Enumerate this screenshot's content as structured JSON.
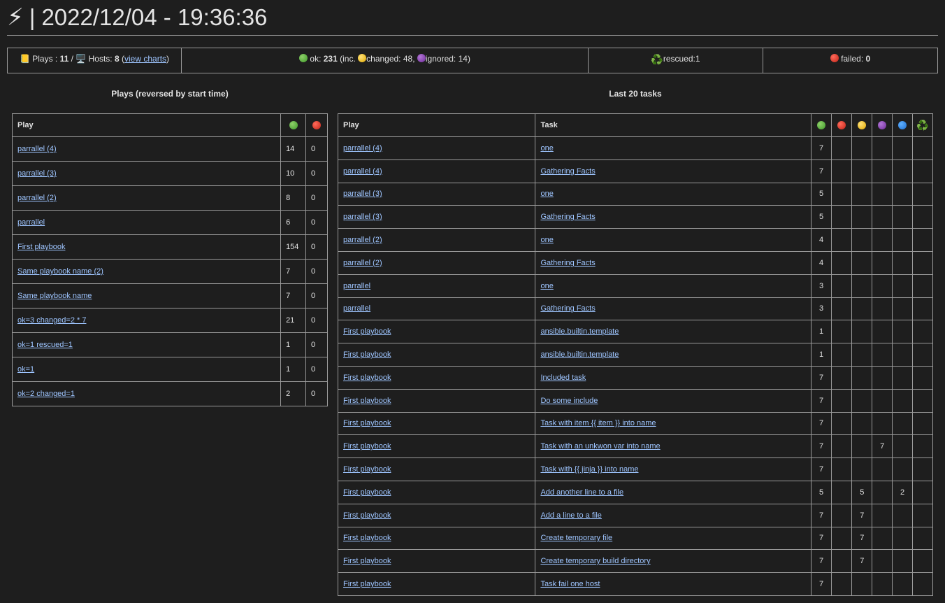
{
  "header": {
    "bolt_icon": "⚡",
    "separator": "|",
    "datetime": "2022/12/04 - 19:36:36"
  },
  "summary": {
    "plays_icon": "📒",
    "plays_label": "Plays :",
    "plays_count": "11",
    "slash": "/",
    "hosts_icon": "🖥️",
    "hosts_label": "Hosts:",
    "hosts_count": "8",
    "view_charts": "view charts",
    "ok_label": "ok:",
    "ok_count": "231",
    "inc_open": "(inc.",
    "changed_text": "changed: 48,",
    "ignored_text": "ignored: 14)",
    "rescued_icon": "♻️",
    "rescued_text": "rescued:1",
    "failed_label": "failed:",
    "failed_count": "0"
  },
  "plays_section": {
    "title": "Plays (reversed by start time)",
    "col_play": "Play",
    "rows": [
      {
        "play": "parrallel (4)",
        "ok": "14",
        "failed": "0"
      },
      {
        "play": "parrallel (3)",
        "ok": "10",
        "failed": "0"
      },
      {
        "play": "parrallel (2)",
        "ok": "8",
        "failed": "0"
      },
      {
        "play": "parrallel",
        "ok": "6",
        "failed": "0"
      },
      {
        "play": "First playbook",
        "ok": "154",
        "failed": "0"
      },
      {
        "play": "Same playbook name (2)",
        "ok": "7",
        "failed": "0"
      },
      {
        "play": "Same playbook name",
        "ok": "7",
        "failed": "0"
      },
      {
        "play": "ok=3 changed=2 * 7",
        "ok": "21",
        "failed": "0"
      },
      {
        "play": "ok=1 rescued=1",
        "ok": "1",
        "failed": "0"
      },
      {
        "play": "ok=1",
        "ok": "1",
        "failed": "0"
      },
      {
        "play": "ok=2 changed=1",
        "ok": "2",
        "failed": "0"
      }
    ]
  },
  "tasks_section": {
    "title": "Last 20 tasks",
    "col_play": "Play",
    "col_task": "Task",
    "recycle_icon": "♻️",
    "rows": [
      {
        "play": "parrallel (4)",
        "task": "one",
        "ok": "7",
        "failed": "",
        "changed": "",
        "ignored": "",
        "skipped": "",
        "rescued": ""
      },
      {
        "play": "parrallel (4)",
        "task": "Gathering Facts",
        "ok": "7",
        "failed": "",
        "changed": "",
        "ignored": "",
        "skipped": "",
        "rescued": ""
      },
      {
        "play": "parrallel (3)",
        "task": "one",
        "ok": "5",
        "failed": "",
        "changed": "",
        "ignored": "",
        "skipped": "",
        "rescued": ""
      },
      {
        "play": "parrallel (3)",
        "task": "Gathering Facts",
        "ok": "5",
        "failed": "",
        "changed": "",
        "ignored": "",
        "skipped": "",
        "rescued": ""
      },
      {
        "play": "parrallel (2)",
        "task": "one",
        "ok": "4",
        "failed": "",
        "changed": "",
        "ignored": "",
        "skipped": "",
        "rescued": ""
      },
      {
        "play": "parrallel (2)",
        "task": "Gathering Facts",
        "ok": "4",
        "failed": "",
        "changed": "",
        "ignored": "",
        "skipped": "",
        "rescued": ""
      },
      {
        "play": "parrallel",
        "task": "one",
        "ok": "3",
        "failed": "",
        "changed": "",
        "ignored": "",
        "skipped": "",
        "rescued": ""
      },
      {
        "play": "parrallel",
        "task": "Gathering Facts",
        "ok": "3",
        "failed": "",
        "changed": "",
        "ignored": "",
        "skipped": "",
        "rescued": ""
      },
      {
        "play": "First playbook",
        "task": "ansible.builtin.template",
        "ok": "1",
        "failed": "",
        "changed": "",
        "ignored": "",
        "skipped": "",
        "rescued": ""
      },
      {
        "play": "First playbook",
        "task": "ansible.builtin.template",
        "ok": "1",
        "failed": "",
        "changed": "",
        "ignored": "",
        "skipped": "",
        "rescued": ""
      },
      {
        "play": "First playbook",
        "task": "Included task",
        "ok": "7",
        "failed": "",
        "changed": "",
        "ignored": "",
        "skipped": "",
        "rescued": ""
      },
      {
        "play": "First playbook",
        "task": "Do some include",
        "ok": "7",
        "failed": "",
        "changed": "",
        "ignored": "",
        "skipped": "",
        "rescued": ""
      },
      {
        "play": "First playbook",
        "task": "Task with item {{ item }} into name",
        "ok": "7",
        "failed": "",
        "changed": "",
        "ignored": "",
        "skipped": "",
        "rescued": ""
      },
      {
        "play": "First playbook",
        "task": "Task with an unkwon var into name",
        "ok": "7",
        "failed": "",
        "changed": "",
        "ignored": "7",
        "skipped": "",
        "rescued": ""
      },
      {
        "play": "First playbook",
        "task": "Task with {{ jinja }} into name",
        "ok": "7",
        "failed": "",
        "changed": "",
        "ignored": "",
        "skipped": "",
        "rescued": ""
      },
      {
        "play": "First playbook",
        "task": "Add another line to a file",
        "ok": "5",
        "failed": "",
        "changed": "5",
        "ignored": "",
        "skipped": "2",
        "rescued": ""
      },
      {
        "play": "First playbook",
        "task": "Add a line to a file",
        "ok": "7",
        "failed": "",
        "changed": "7",
        "ignored": "",
        "skipped": "",
        "rescued": ""
      },
      {
        "play": "First playbook",
        "task": "Create temporary file",
        "ok": "7",
        "failed": "",
        "changed": "7",
        "ignored": "",
        "skipped": "",
        "rescued": ""
      },
      {
        "play": "First playbook",
        "task": "Create temporary build directory",
        "ok": "7",
        "failed": "",
        "changed": "7",
        "ignored": "",
        "skipped": "",
        "rescued": ""
      },
      {
        "play": "First playbook",
        "task": "Task fail one host",
        "ok": "7",
        "failed": "",
        "changed": "",
        "ignored": "",
        "skipped": "",
        "rescued": ""
      }
    ]
  }
}
